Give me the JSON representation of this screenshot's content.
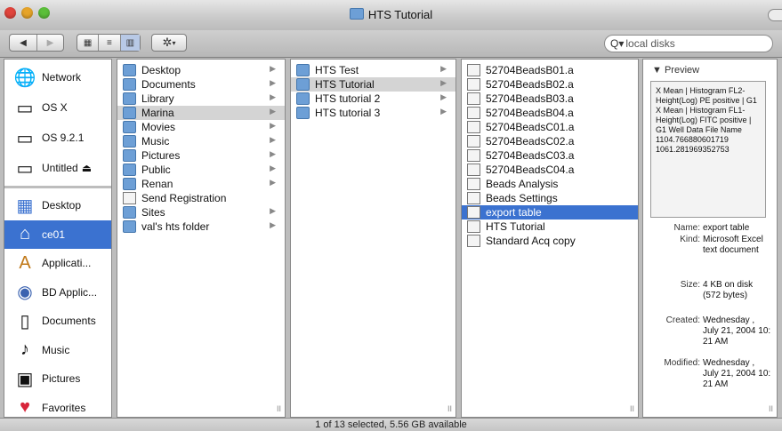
{
  "window": {
    "title": "HTS Tutorial",
    "status": "1 of 13 selected, 5.56 GB available"
  },
  "toolbar": {
    "back_icon": "back-arrow",
    "forward_icon": "forward-arrow",
    "view_icon": "icon-view",
    "list_icon": "list-view",
    "column_icon": "column-view",
    "action_icon": "gear",
    "search_placeholder": "local disks"
  },
  "sidebar": {
    "devices": [
      {
        "label": "Network",
        "icon": "globe"
      },
      {
        "label": "OS X",
        "icon": "hard-disk"
      },
      {
        "label": "OS 9.2.1",
        "icon": "hard-disk"
      },
      {
        "label": "Untitled",
        "icon": "disk-eject"
      }
    ],
    "places": [
      {
        "label": "Desktop",
        "icon": "desktop"
      },
      {
        "label": "ce01",
        "icon": "home",
        "selected": true
      },
      {
        "label": "Applicati...",
        "icon": "applications"
      },
      {
        "label": "BD Applic...",
        "icon": "bd-app"
      },
      {
        "label": "Documents",
        "icon": "document"
      },
      {
        "label": "Music",
        "icon": "music"
      },
      {
        "label": "Pictures",
        "icon": "pictures"
      },
      {
        "label": "Favorites",
        "icon": "heart"
      }
    ]
  },
  "columns": [
    {
      "items": [
        {
          "label": "Desktop",
          "arrow": true,
          "state": ""
        },
        {
          "label": "Documents",
          "arrow": true,
          "state": ""
        },
        {
          "label": "Library",
          "arrow": true,
          "state": ""
        },
        {
          "label": "Marina",
          "arrow": true,
          "state": "gray"
        },
        {
          "label": "Movies",
          "arrow": true,
          "state": ""
        },
        {
          "label": "Music",
          "arrow": true,
          "state": ""
        },
        {
          "label": "Pictures",
          "arrow": true,
          "state": ""
        },
        {
          "label": "Public",
          "arrow": true,
          "state": ""
        },
        {
          "label": "Renan",
          "arrow": true,
          "state": ""
        },
        {
          "label": "Send Registration",
          "arrow": false,
          "state": ""
        },
        {
          "label": "Sites",
          "arrow": true,
          "state": ""
        },
        {
          "label": "val's hts folder",
          "arrow": true,
          "state": ""
        }
      ]
    },
    {
      "items": [
        {
          "label": "HTS Test",
          "arrow": true,
          "state": ""
        },
        {
          "label": "HTS Tutorial",
          "arrow": true,
          "state": "gray"
        },
        {
          "label": "HTS tutorial 2",
          "arrow": true,
          "state": ""
        },
        {
          "label": "HTS tutorial 3",
          "arrow": true,
          "state": ""
        }
      ]
    },
    {
      "items": [
        {
          "label": "52704BeadsB01.a",
          "arrow": false,
          "state": ""
        },
        {
          "label": "52704BeadsB02.a",
          "arrow": false,
          "state": ""
        },
        {
          "label": "52704BeadsB03.a",
          "arrow": false,
          "state": ""
        },
        {
          "label": "52704BeadsB04.a",
          "arrow": false,
          "state": ""
        },
        {
          "label": "52704BeadsC01.a",
          "arrow": false,
          "state": ""
        },
        {
          "label": "52704BeadsC02.a",
          "arrow": false,
          "state": ""
        },
        {
          "label": "52704BeadsC03.a",
          "arrow": false,
          "state": ""
        },
        {
          "label": "52704BeadsC04.a",
          "arrow": false,
          "state": ""
        },
        {
          "label": "Beads Analysis",
          "arrow": false,
          "state": ""
        },
        {
          "label": "Beads Settings",
          "arrow": false,
          "state": ""
        },
        {
          "label": "export table",
          "arrow": false,
          "state": "blue"
        },
        {
          "label": "HTS Tutorial",
          "arrow": false,
          "state": ""
        },
        {
          "label": "Standard Acq copy",
          "arrow": false,
          "state": ""
        }
      ]
    }
  ],
  "preview": {
    "header": "Preview",
    "content": "X Mean | Histogram FL2-Height(Log) PE positive | G1 X Mean | Histogram FL1-Height(Log) FITC positive | G1 Well Data File Name 1104.766880601719 1061.281969352753",
    "info": [
      {
        "key": "Name:",
        "value": "export table"
      },
      {
        "key": "Kind:",
        "value": "Microsoft Excel text document"
      },
      {
        "key": "Size:",
        "value": "4 KB on disk (572 bytes)"
      },
      {
        "key": "Created:",
        "value": "Wednesday , July 21, 2004 10: 21 AM"
      },
      {
        "key": "Modified:",
        "value": "Wednesday , July 21, 2004 10: 21 AM"
      }
    ]
  },
  "colors": {
    "selection": "#3b72d0",
    "folder": "#6d9fd6"
  }
}
